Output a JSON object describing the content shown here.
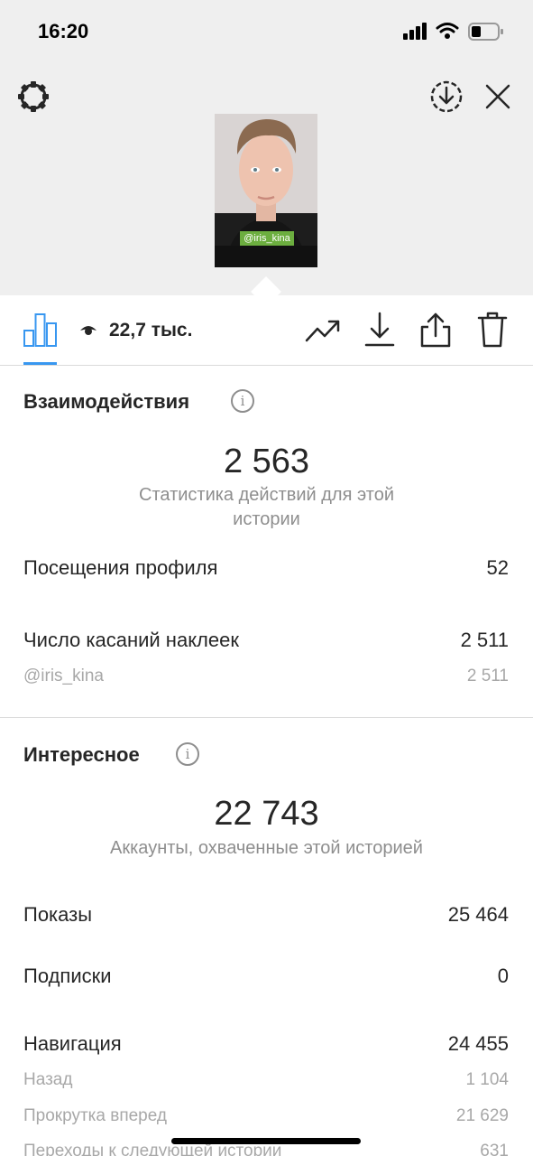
{
  "status_bar": {
    "time": "16:20"
  },
  "story_preview": {
    "sticker_text": "@iris_kina"
  },
  "toolbar": {
    "views": "22,7 тыс."
  },
  "interactions": {
    "title": "Взаимодействия",
    "total": "2 563",
    "caption": "Статистика действий для этой истории",
    "rows": [
      {
        "label": "Посещения профиля",
        "value": "52"
      },
      {
        "label": "Число касаний наклеек",
        "value": "2 511"
      }
    ],
    "sub_rows": [
      {
        "label": "@iris_kina",
        "value": "2 511"
      }
    ]
  },
  "discovery": {
    "title": "Интересное",
    "total": "22 743",
    "caption": "Аккаунты, охваченные этой историей",
    "rows": [
      {
        "label": "Показы",
        "value": "25 464"
      },
      {
        "label": "Подписки",
        "value": "0"
      },
      {
        "label": "Навигация",
        "value": "24 455"
      }
    ],
    "sub_rows": [
      {
        "label": "Назад",
        "value": "1 104"
      },
      {
        "label": "Прокрутка вперед",
        "value": "21 629"
      },
      {
        "label": "Переходы к следующей истории",
        "value": "631"
      }
    ]
  }
}
